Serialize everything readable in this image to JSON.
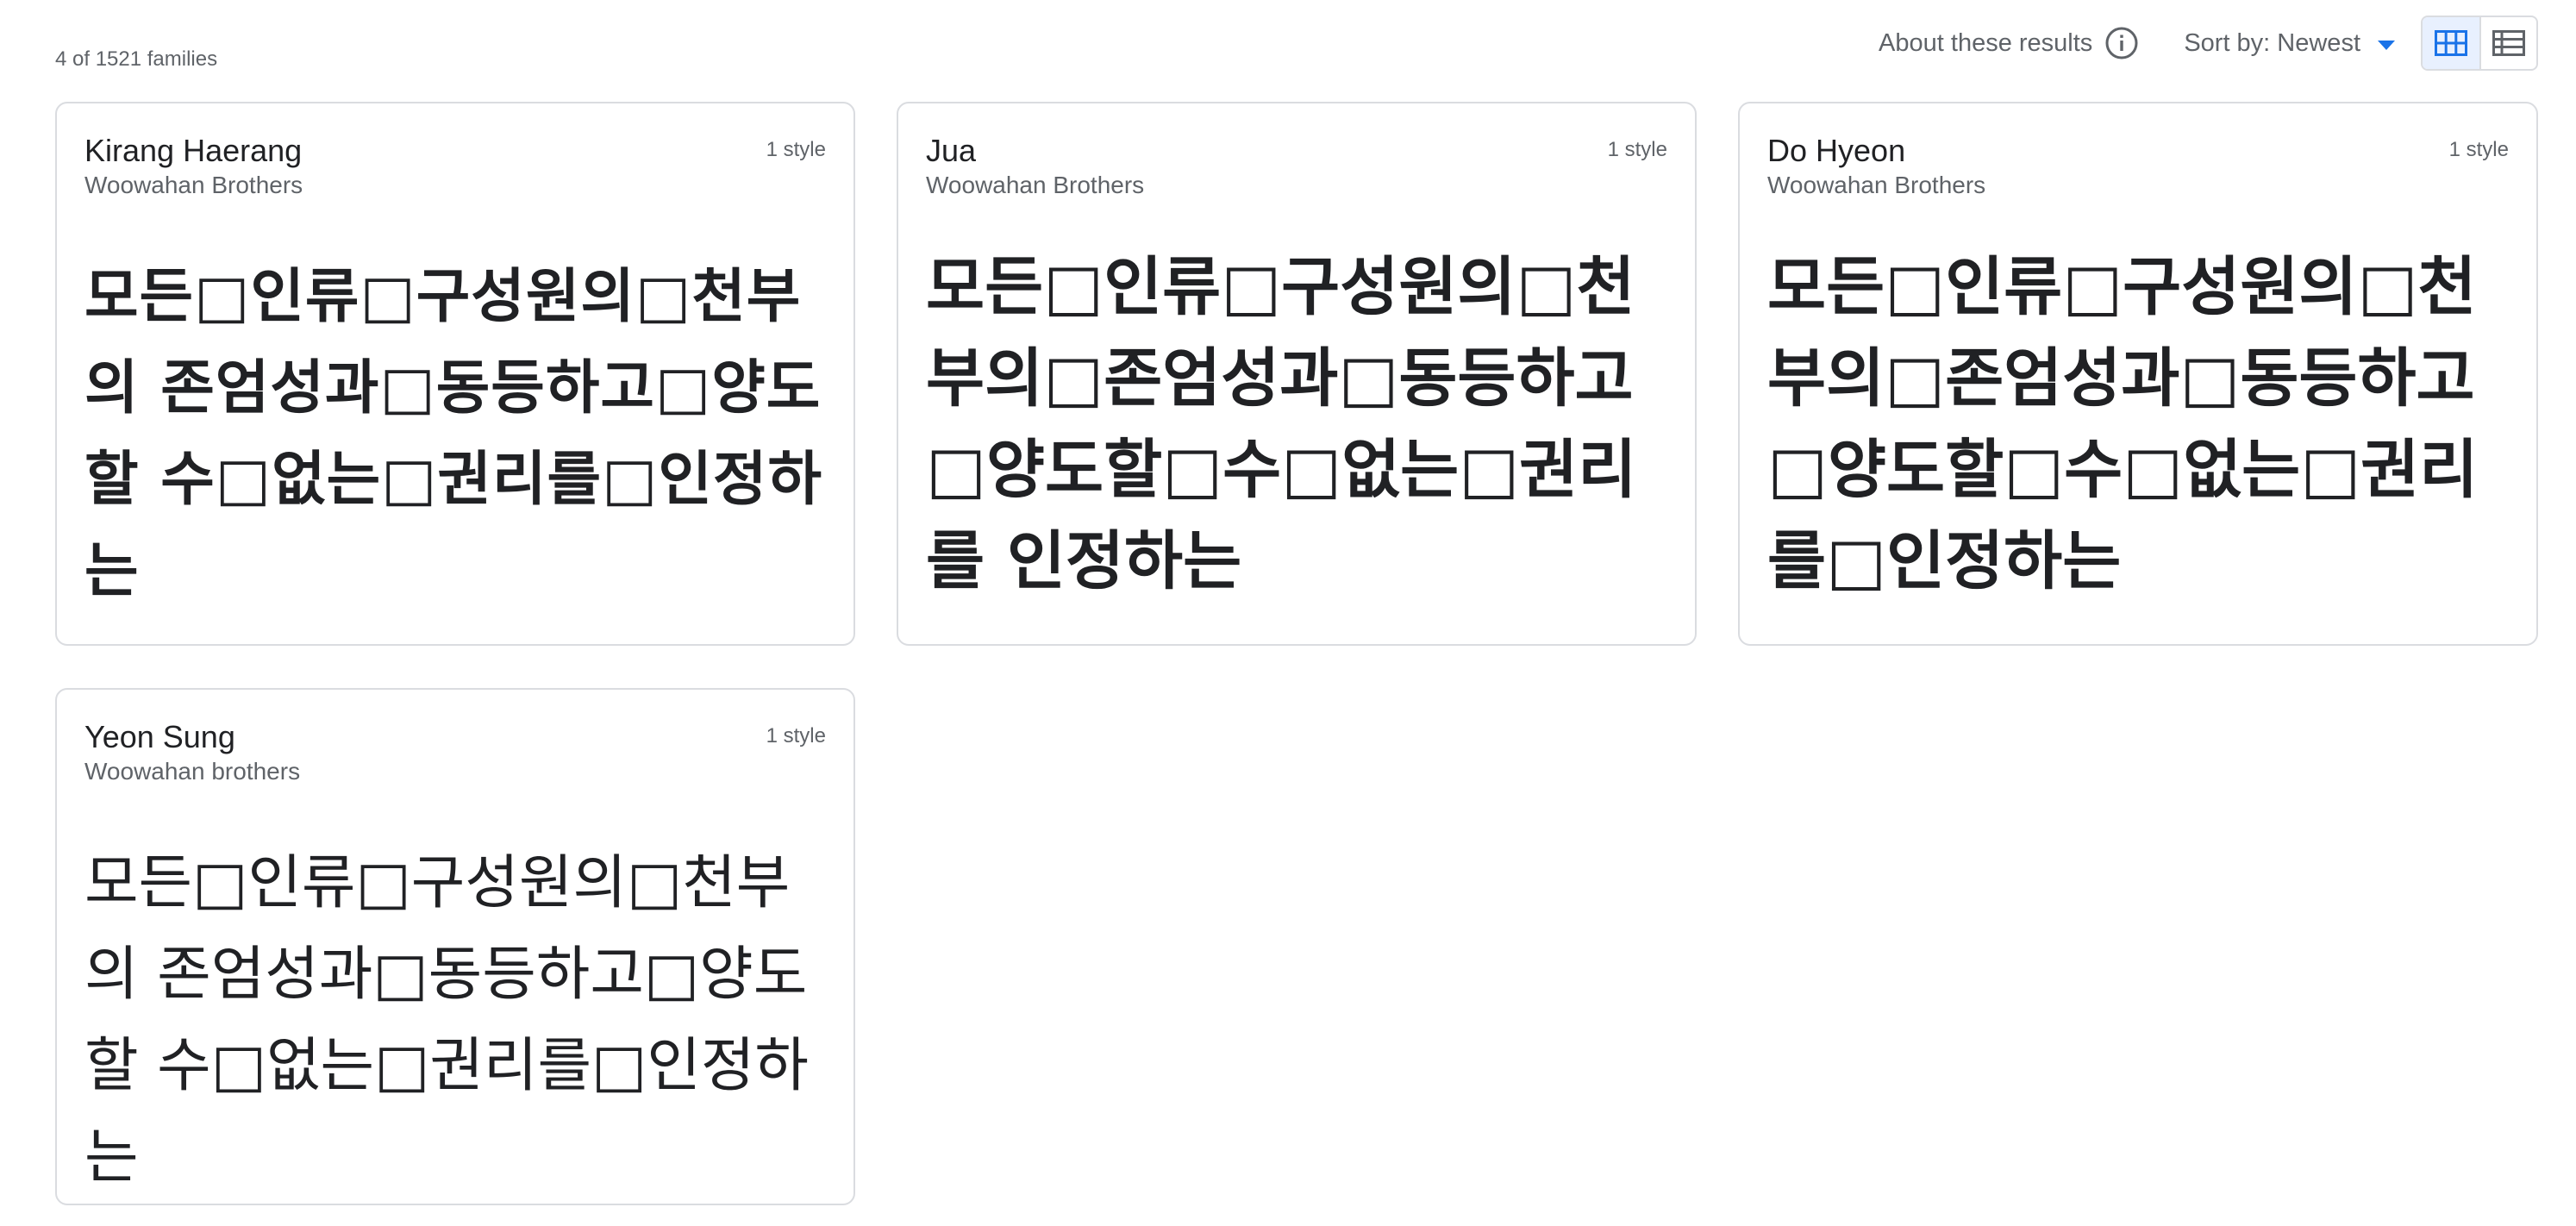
{
  "results": {
    "count_text": "4 of 1521 families"
  },
  "toolbar": {
    "about_label": "About these results",
    "sort_label": "Sort by: Newest",
    "info_icon": "info-icon",
    "grid_view_icon": "grid-view-icon",
    "list_view_icon": "list-view-icon",
    "accent_color": "#1a73e8"
  },
  "cards": [
    {
      "name": "Kirang Haerang",
      "designer": "Woowahan Brothers",
      "styles": "1 style",
      "sample": "모든□인류□구성원의□천부의 존엄성과□동등하고□양도할 수□없는□권리를□인정하는"
    },
    {
      "name": "Jua",
      "designer": "Woowahan Brothers",
      "styles": "1 style",
      "sample": "모든□인류□구성원의□천부의□존엄성과□동등하고□양도할□수□없는□권리를 인정하는"
    },
    {
      "name": "Do Hyeon",
      "designer": "Woowahan Brothers",
      "styles": "1 style",
      "sample": "모든□인류□구성원의□천부의□존엄성과□동등하고□양도할□수□없는□권리를□인정하는"
    },
    {
      "name": "Yeon Sung",
      "designer": "Woowahan brothers",
      "styles": "1 style",
      "sample": "모든□인류□구성원의□천부의 존엄성과□동등하고□양도할 수□없는□권리를□인정하는"
    }
  ]
}
